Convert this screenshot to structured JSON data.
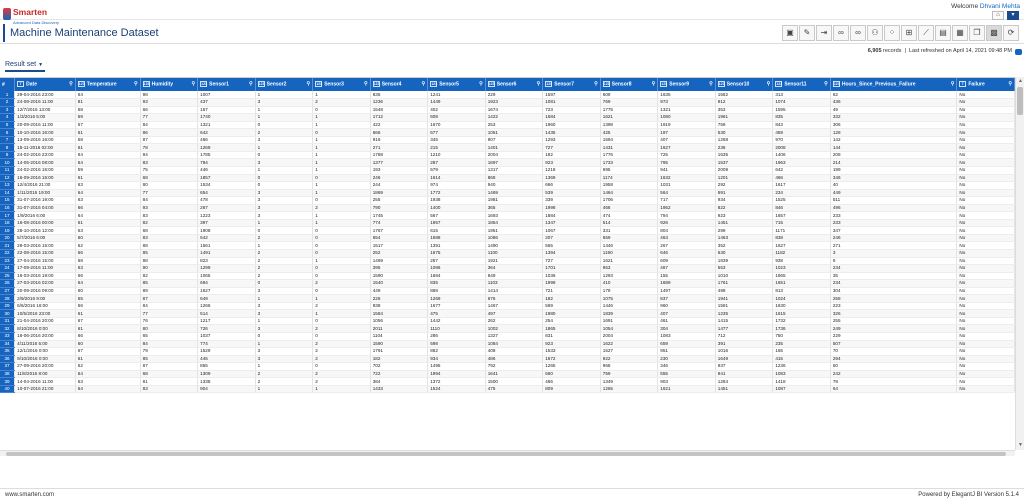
{
  "brand": {
    "name": "Smarten",
    "tagline": "Advanced Data Discovery"
  },
  "welcome": {
    "prefix": "Welcome",
    "user": "Dhvani Mehta"
  },
  "nav": {
    "home_icon": "home-icon",
    "menu_icon": "chevron-down-icon"
  },
  "page_title": "Machine Maintenance Dataset",
  "toolbar_icons": [
    "save-icon",
    "edit-icon",
    "export-icon",
    "link-icon",
    "link-icon",
    "share-icon",
    "scatter-icon",
    "grid-icon",
    "chart-icon",
    "table-icon",
    "calendar-icon",
    "copy-icon",
    "grid-view-icon",
    "settings-icon"
  ],
  "status": {
    "record_count": "6,905",
    "records_label": "records",
    "refreshed_label": "Last refreshed on",
    "refreshed_value": "April 14, 2021 09:48 PM"
  },
  "result_set": {
    "label": "Result set"
  },
  "columns": [
    {
      "name": "#",
      "type": ""
    },
    {
      "name": "Date",
      "type": "T"
    },
    {
      "name": "Temperature",
      "type": "123"
    },
    {
      "name": "Humidity",
      "type": "123"
    },
    {
      "name": "Sensor1",
      "type": "123"
    },
    {
      "name": "Sensor2",
      "type": "123"
    },
    {
      "name": "Sensor3",
      "type": "123"
    },
    {
      "name": "Sensor4",
      "type": "123"
    },
    {
      "name": "Sensor5",
      "type": "123"
    },
    {
      "name": "Sensor6",
      "type": "123"
    },
    {
      "name": "Sensor7",
      "type": "123"
    },
    {
      "name": "Sensor8",
      "type": "123"
    },
    {
      "name": "Sensor9",
      "type": "123"
    },
    {
      "name": "Sensor10",
      "type": "123"
    },
    {
      "name": "Sensor11",
      "type": "123"
    },
    {
      "name": "Hours_Since_Previous_Failure",
      "type": "123"
    },
    {
      "name": "Failure",
      "type": "T"
    }
  ],
  "rows": [
    [
      "1",
      "29-04-2016 23:00",
      "64",
      "98",
      "1007",
      "1",
      "1",
      "835",
      "1241",
      "229",
      "1597",
      "609",
      "1635",
      "1582",
      "313",
      "62",
      "No"
    ],
    [
      "2",
      "24-08-2016 11:00",
      "81",
      "93",
      "437",
      "3",
      "2",
      "1236",
      "1449",
      "1923",
      "1081",
      "769",
      "973",
      "912",
      "1074",
      "436",
      "No"
    ],
    [
      "3",
      "12/7/2016 13:00",
      "68",
      "66",
      "167",
      "1",
      "0",
      "1548",
      "402",
      "1674",
      "723",
      "1775",
      "1321",
      "353",
      "1595",
      "49",
      "No"
    ],
    [
      "4",
      "1/3/2016 5:00",
      "59",
      "77",
      "1740",
      "1",
      "1",
      "1712",
      "608",
      "1422",
      "1684",
      "1621",
      "1080",
      "1961",
      "835",
      "332",
      "No"
    ],
    [
      "5",
      "20-09-2016 11:00",
      "57",
      "84",
      "1321",
      "0",
      "1",
      "422",
      "1670",
      "253",
      "1960",
      "1398",
      "1919",
      "759",
      "843",
      "306",
      "No"
    ],
    [
      "6",
      "10-10-2016 16:00",
      "61",
      "86",
      "642",
      "2",
      "0",
      "666",
      "677",
      "1051",
      "1435",
      "425",
      "197",
      "530",
      "459",
      "128",
      "No"
    ],
    [
      "7",
      "13-09-2016 16:00",
      "58",
      "87",
      "466",
      "3",
      "1",
      "916",
      "345",
      "907",
      "1293",
      "1594",
      "407",
      "1268",
      "970",
      "142",
      "No"
    ],
    [
      "8",
      "15-11-2016 02:00",
      "61",
      "78",
      "1269",
      "1",
      "1",
      "271",
      "215",
      "1401",
      "727",
      "1431",
      "1627",
      "236",
      "2008",
      "144",
      "No"
    ],
    [
      "9",
      "24-02-2016 23:00",
      "64",
      "94",
      "1785",
      "0",
      "1",
      "1788",
      "1210",
      "2004",
      "182",
      "1776",
      "725",
      "1635",
      "1406",
      "208",
      "No"
    ],
    [
      "10",
      "14-05-2016 08:00",
      "64",
      "83",
      "794",
      "3",
      "1",
      "1377",
      "287",
      "1697",
      "923",
      "1733",
      "795",
      "1537",
      "1963",
      "214",
      "No"
    ],
    [
      "11",
      "24-02-2016 16:00",
      "59",
      "75",
      "446",
      "1",
      "1",
      "193",
      "579",
      "1317",
      "1218",
      "695",
      "941",
      "2009",
      "642",
      "199",
      "No"
    ],
    [
      "12",
      "16-09-2016 15:00",
      "61",
      "68",
      "1857",
      "0",
      "0",
      "246",
      "1614",
      "868",
      "1369",
      "1174",
      "1632",
      "1201",
      "466",
      "346",
      "No"
    ],
    [
      "13",
      "12/4/2016 21:00",
      "63",
      "80",
      "1534",
      "0",
      "1",
      "244",
      "974",
      "940",
      "666",
      "1958",
      "1031",
      "292",
      "1617",
      "40",
      "No"
    ],
    [
      "14",
      "1/11/2016 19:00",
      "64",
      "77",
      "654",
      "3",
      "1",
      "1869",
      "1772",
      "1469",
      "539",
      "1464",
      "564",
      "691",
      "234",
      "449",
      "No"
    ],
    [
      "15",
      "31-07-2016 19:00",
      "63",
      "84",
      "478",
      "3",
      "0",
      "255",
      "1938",
      "1981",
      "339",
      "1706",
      "717",
      "934",
      "1525",
      "511",
      "No"
    ],
    [
      "16",
      "31-07-2016 04:00",
      "66",
      "93",
      "267",
      "3",
      "2",
      "790",
      "1400",
      "365",
      "1998",
      "466",
      "1952",
      "822",
      "846",
      "496",
      "No"
    ],
    [
      "17",
      "1/9/2016 6:00",
      "64",
      "83",
      "1223",
      "3",
      "1",
      "1745",
      "567",
      "1693",
      "1884",
      "474",
      "794",
      "923",
      "1657",
      "233",
      "No"
    ],
    [
      "18",
      "16-08-2016 00:00",
      "61",
      "82",
      "397",
      "1",
      "1",
      "774",
      "1957",
      "1854",
      "1347",
      "514",
      "926",
      "1451",
      "715",
      "233",
      "No"
    ],
    [
      "19",
      "28-10-2016 12:00",
      "63",
      "68",
      "1908",
      "0",
      "0",
      "1767",
      "615",
      "1951",
      "1067",
      "331",
      "804",
      "299",
      "1171",
      "347",
      "No"
    ],
    [
      "20",
      "5/7/2016 6:00",
      "60",
      "83",
      "542",
      "2",
      "0",
      "654",
      "1688",
      "1086",
      "207",
      "659",
      "463",
      "1463",
      "838",
      "246",
      "No"
    ],
    [
      "21",
      "28-03-2016 15:00",
      "62",
      "88",
      "1561",
      "1",
      "0",
      "1517",
      "1391",
      "1490",
      "555",
      "1446",
      "267",
      "352",
      "1627",
      "271",
      "No"
    ],
    [
      "22",
      "22-08-2016 15:00",
      "66",
      "85",
      "1491",
      "2",
      "0",
      "252",
      "1675",
      "1100",
      "1394",
      "1190",
      "646",
      "630",
      "1182",
      "3",
      "No"
    ],
    [
      "23",
      "27-04-2016 15:00",
      "68",
      "88",
      "823",
      "2",
      "1",
      "1469",
      "267",
      "1921",
      "727",
      "1621",
      "609",
      "1839",
      "938",
      "6",
      "No"
    ],
    [
      "24",
      "17-09-2016 11:00",
      "63",
      "90",
      "1299",
      "2",
      "0",
      "395",
      "1086",
      "364",
      "1701",
      "953",
      "467",
      "553",
      "1023",
      "234",
      "No"
    ],
    [
      "25",
      "16-03-2016 19:00",
      "66",
      "82",
      "1065",
      "2",
      "0",
      "1590",
      "1684",
      "849",
      "1036",
      "1293",
      "155",
      "1010",
      "1665",
      "35",
      "No"
    ],
    [
      "26",
      "27-03-2016 02:00",
      "64",
      "85",
      "694",
      "0",
      "2",
      "1540",
      "835",
      "1103",
      "1999",
      "410",
      "1689",
      "1761",
      "1651",
      "234",
      "No"
    ],
    [
      "27",
      "20-09-2016 09:00",
      "60",
      "89",
      "1627",
      "3",
      "0",
      "449",
      "868",
      "1414",
      "721",
      "179",
      "1497",
      "498",
      "813",
      "304",
      "No"
    ],
    [
      "28",
      "2/9/2016 9:00",
      "65",
      "87",
      "649",
      "1",
      "1",
      "226",
      "1269",
      "676",
      "182",
      "1075",
      "837",
      "1941",
      "1024",
      "258",
      "No"
    ],
    [
      "29",
      "6/6/2016 16:00",
      "66",
      "84",
      "1266",
      "3",
      "2",
      "938",
      "1677",
      "1467",
      "569",
      "1446",
      "960",
      "1591",
      "1630",
      "223",
      "No"
    ],
    [
      "30",
      "10/5/2016 23:00",
      "61",
      "77",
      "514",
      "3",
      "1",
      "1584",
      "475",
      "497",
      "1980",
      "1839",
      "407",
      "1235",
      "1615",
      "326",
      "No"
    ],
    [
      "31",
      "21-04-2016 20:00",
      "67",
      "76",
      "1217",
      "1",
      "0",
      "1056",
      "1442",
      "262",
      "254",
      "1691",
      "461",
      "1415",
      "1732",
      "255",
      "No"
    ],
    [
      "32",
      "8/10/2016 0:00",
      "61",
      "80",
      "726",
      "3",
      "2",
      "2011",
      "1110",
      "1002",
      "1865",
      "1054",
      "304",
      "1477",
      "1736",
      "249",
      "No"
    ],
    [
      "33",
      "16-06-2016 20:00",
      "66",
      "65",
      "1037",
      "0",
      "0",
      "1104",
      "286",
      "1327",
      "831",
      "2004",
      "1083",
      "712",
      "750",
      "229",
      "No"
    ],
    [
      "34",
      "4/11/2016 5:00",
      "60",
      "84",
      "774",
      "1",
      "2",
      "1590",
      "598",
      "1084",
      "923",
      "1622",
      "659",
      "391",
      "235",
      "507",
      "No"
    ],
    [
      "35",
      "12/1/2016 0:00",
      "67",
      "79",
      "1529",
      "3",
      "2",
      "1791",
      "862",
      "408",
      "1533",
      "1527",
      "951",
      "1016",
      "165",
      "70",
      "No"
    ],
    [
      "36",
      "9/10/2016 0:00",
      "61",
      "85",
      "445",
      "3",
      "2",
      "182",
      "934",
      "486",
      "1672",
      "922",
      "230",
      "1649",
      "415",
      "294",
      "No"
    ],
    [
      "37",
      "27-09-2016 20:00",
      "62",
      "87",
      "855",
      "1",
      "0",
      "702",
      "1495",
      "792",
      "1265",
      "968",
      "346",
      "937",
      "1236",
      "50",
      "No"
    ],
    [
      "38",
      "11/8/2016 8:00",
      "64",
      "68",
      "1309",
      "2",
      "2",
      "722",
      "1994",
      "1641",
      "560",
      "759",
      "555",
      "941",
      "1083",
      "242",
      "No"
    ],
    [
      "39",
      "14-04-2016 11:00",
      "63",
      "81",
      "1338",
      "2",
      "2",
      "384",
      "1372",
      "1500",
      "466",
      "1349",
      "903",
      "1284",
      "1418",
      "78",
      "No"
    ],
    [
      "40",
      "10-07-2016 21:00",
      "64",
      "83",
      "904",
      "1",
      "1",
      "1433",
      "1524",
      "475",
      "809",
      "1265",
      "1621",
      "1451",
      "1087",
      "64",
      "No"
    ]
  ],
  "footer": {
    "left": "www.smarten.com",
    "right": "Powered by ElegantJ BI Version 5.1.4"
  }
}
